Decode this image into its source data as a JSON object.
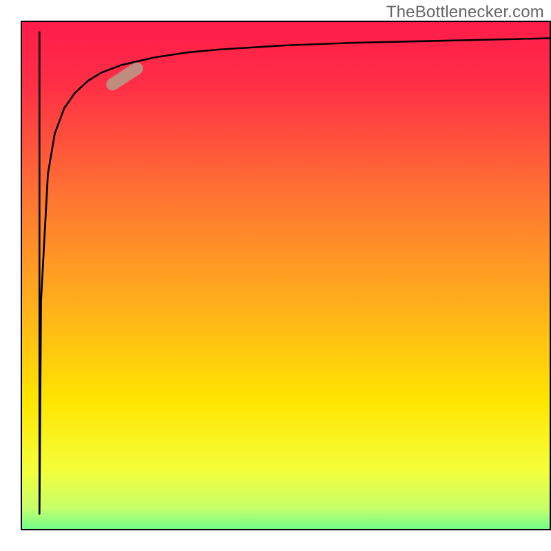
{
  "watermark": "TheBottlenecker.com",
  "colors": {
    "frame": "#000000",
    "highlight": "#c18c80",
    "gradient_stops": [
      {
        "offset": 0,
        "color": "#ff1c4a"
      },
      {
        "offset": 0.12,
        "color": "#ff2f46"
      },
      {
        "offset": 0.35,
        "color": "#ff7a30"
      },
      {
        "offset": 0.55,
        "color": "#ffb31a"
      },
      {
        "offset": 0.72,
        "color": "#ffe600"
      },
      {
        "offset": 0.85,
        "color": "#f4ff3a"
      },
      {
        "offset": 0.92,
        "color": "#c8ff6a"
      },
      {
        "offset": 0.965,
        "color": "#6aff8e"
      },
      {
        "offset": 1.0,
        "color": "#00e676"
      }
    ]
  },
  "chart_data": {
    "type": "line",
    "title": "",
    "xlabel": "",
    "ylabel": "",
    "xlim": [
      0,
      100
    ],
    "ylim": [
      0,
      100
    ],
    "annotations": [
      {
        "type": "watermark",
        "text": "TheBottlenecker.com",
        "position": "top-right"
      }
    ],
    "series": [
      {
        "name": "main-curve",
        "color": "#000000",
        "x": [
          3.3,
          3.3,
          3.6,
          4.9,
          6.2,
          8.0,
          10.0,
          12.5,
          15.0,
          18.8,
          25.0,
          31.3,
          37.5,
          50.0,
          62.5,
          75.0,
          87.5,
          100.0
        ],
        "y": [
          98.0,
          3.0,
          45.0,
          70.0,
          78.0,
          83.0,
          86.0,
          88.4,
          90.0,
          91.5,
          93.0,
          94.0,
          94.6,
          95.4,
          95.9,
          96.2,
          96.5,
          96.8
        ]
      },
      {
        "name": "highlight-segment",
        "color": "#c18c80",
        "x": [
          16.3,
          22.5
        ],
        "y": [
          87.5,
          91.2
        ]
      }
    ]
  },
  "highlight_pos": {
    "left_pct": 19.5,
    "top_pct": 10.8,
    "rotate_deg": -33
  }
}
